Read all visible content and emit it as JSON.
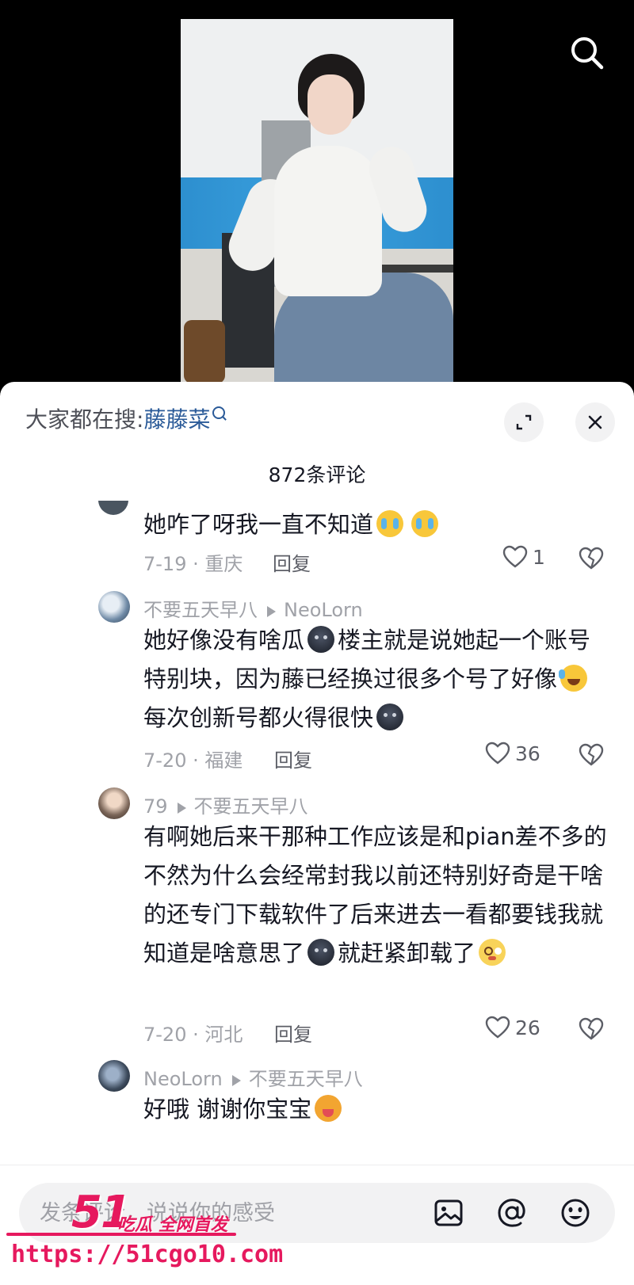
{
  "hot_search": {
    "prefix": "大家都在搜:",
    "keyword": "藤藤菜"
  },
  "comment_count": "872条评论",
  "comments": [
    {
      "text_parts": [
        "她咋了呀我一直不知道",
        "",
        ""
      ],
      "date_location": "7-19 · 重庆",
      "reply_label": "回复",
      "likes": "1"
    },
    {
      "author": "不要五天早八",
      "reply_to": "NeoLorn",
      "text_parts": [
        "她好像没有啥瓜",
        "楼主就是说她起一个账号特别块，因为藤已经换过很多个号了好像",
        "每次创新号都火得很快",
        ""
      ],
      "date_location": "7-20 · 福建",
      "reply_label": "回复",
      "likes": "36"
    },
    {
      "author": "79",
      "reply_to": "不要五天早八",
      "text_parts": [
        "有啊她后来干那种工作应该是和pian差不多的不然为什么会经常封我以前还特别好奇是干啥的还专门下载软件了后来进去一看都要钱我就知道是啥意思了",
        "就赶紧卸载了",
        ""
      ],
      "date_location": "7-20 · 河北",
      "reply_label": "回复",
      "likes": "26"
    },
    {
      "author": "NeoLorn",
      "reply_to": "不要五天早八",
      "text_parts": [
        "好哦  谢谢你宝宝",
        ""
      ]
    }
  ],
  "input": {
    "placeholder": "发条评论，说说你的感受"
  },
  "icons": [
    "search-icon",
    "expand-icon",
    "close-icon",
    "heart-icon",
    "dislike-icon",
    "image-icon",
    "at-icon",
    "emoji-icon"
  ],
  "watermark": {
    "logo": "51",
    "tagline": "吃瓜 全网首发",
    "url": "https://51cgo10.com"
  },
  "colors": {
    "keyword": "#2a5a98",
    "meta": "#a0a2a8",
    "watermark": "#e6195e"
  }
}
